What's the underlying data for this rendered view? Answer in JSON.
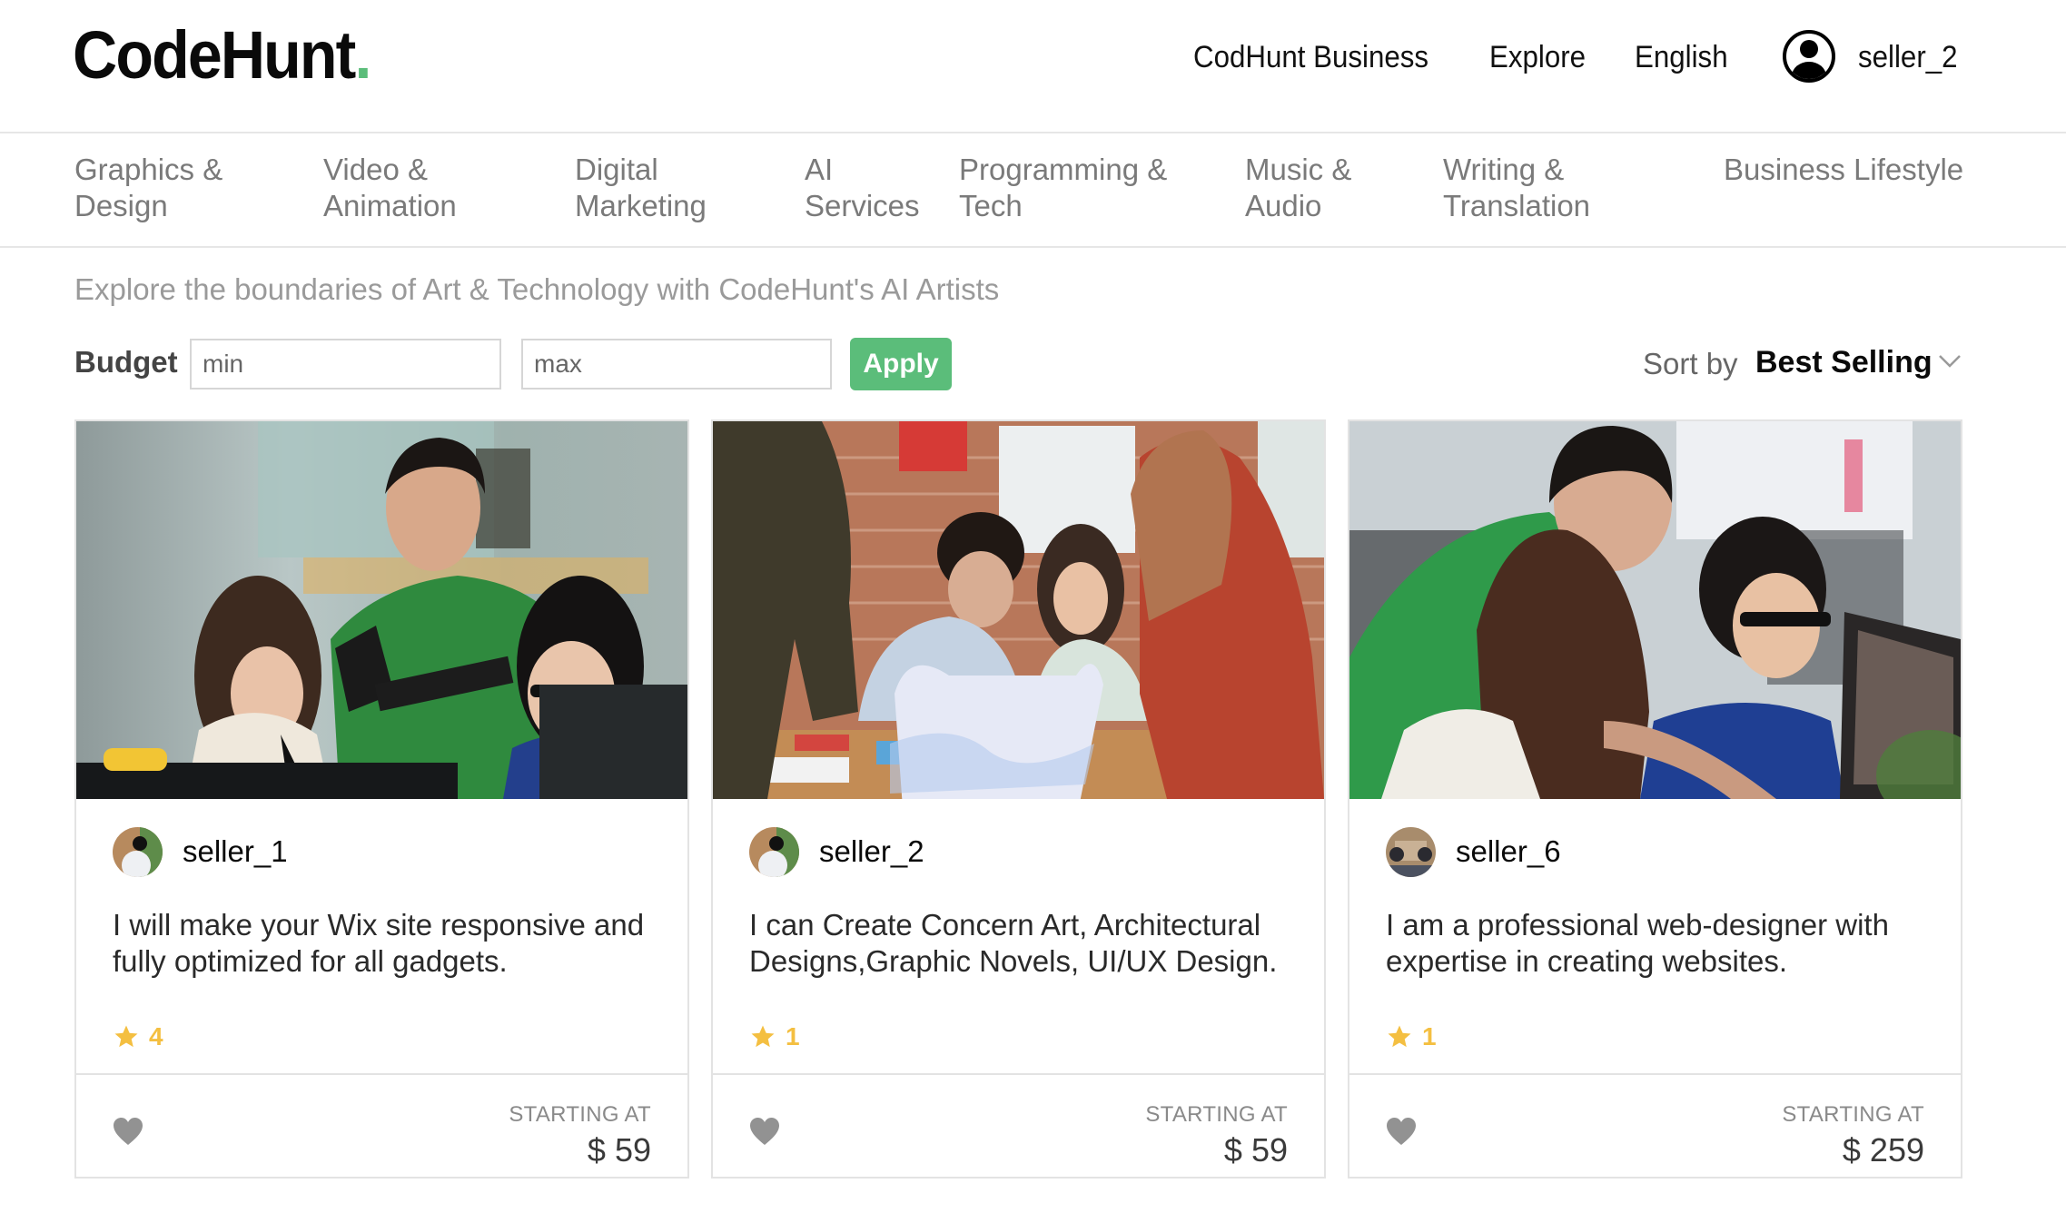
{
  "header": {
    "logo_text": "CodeHunt",
    "logo_dot": ".",
    "accent_color": "#5bbd7a",
    "nav": [
      {
        "label": "CodHunt Business"
      },
      {
        "label": "Explore"
      },
      {
        "label": "English"
      }
    ],
    "user": {
      "icon": "user-circle-icon",
      "name": "seller_2"
    }
  },
  "categories": [
    {
      "label": "Graphics &\nDesign"
    },
    {
      "label": "Video &\nAnimation"
    },
    {
      "label": "Digital\nMarketing"
    },
    {
      "label": "AI\nServices"
    },
    {
      "label": "Programming &\nTech"
    },
    {
      "label": "Music &\nAudio"
    },
    {
      "label": "Writing &\nTranslation"
    },
    {
      "label": "Business Lifestyle"
    }
  ],
  "filters": {
    "tagline": "Explore the boundaries of Art & Technology with CodeHunt's AI Artists",
    "budget_label": "Budget",
    "min_placeholder": "min",
    "max_placeholder": "max",
    "min_value": "",
    "max_value": "",
    "apply_label": "Apply",
    "sort_label": "Sort by",
    "sort_value": "Best Selling"
  },
  "cards": [
    {
      "image_desc": "three coworkers looking at a computer monitor in an office",
      "seller": "seller_1",
      "description": "I will make your Wix site responsive and fully optimized for all gadgets.",
      "rating": "4",
      "starting_label": "STARTING AT",
      "price": "$ 59"
    },
    {
      "image_desc": "team reviewing a blueprint at a table",
      "seller": "seller_2",
      "description": "I can Create Concern Art, Architectural Designs,Graphic Novels, UI/UX Design.",
      "rating": "1",
      "starting_label": "STARTING AT",
      "price": "$ 59"
    },
    {
      "image_desc": "three coworkers at a desk looking at a monitor",
      "seller": "seller_6",
      "description": "I am a professional web-designer with expertise in creating websites.",
      "rating": "1",
      "starting_label": "STARTING AT",
      "price": "$ 259"
    }
  ],
  "colors": {
    "star": "#f4bf41",
    "heart": "#929292",
    "border": "#e3e3e3"
  }
}
